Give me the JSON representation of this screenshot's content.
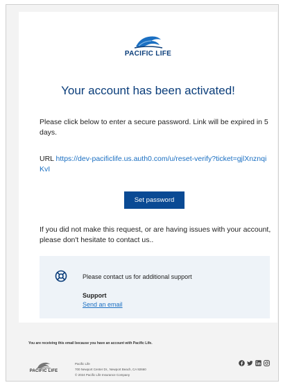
{
  "brand": {
    "name": "PACIFIC LIFE",
    "color": "#0a3d7a"
  },
  "email": {
    "headline": "Your account has been activated!",
    "intro": "Please click below to enter a secure password. Link will be expired in 5 days.",
    "url_label": "URL",
    "url": "https://dev-pacificlife.us.auth0.com/u/reset-verify?ticket=gjlXnznqiKvI",
    "button_label": "Set password",
    "notice": "If you did not make this request, or are having issues with your account, please don't hesitate to contact us.."
  },
  "support": {
    "message": "Please contact us for additional support",
    "title": "Support",
    "link_label": "Send an email",
    "icon": "lifebuoy-icon"
  },
  "footer": {
    "note": "You are receiving this email because you have an account with Pacific Life.",
    "logo_text": "PACIFIC LIFE",
    "address_lines": [
      "Pacific Life",
      "700 Newport Center Dr., Newport Beach, CA 92660",
      "© 2024 Pacific Life Insurance Company"
    ],
    "socials": [
      "facebook-icon",
      "twitter-icon",
      "linkedin-icon",
      "instagram-icon"
    ]
  },
  "colors": {
    "button": "#0a4a94",
    "link": "#1a6fc2",
    "support_bg": "#eef3f8"
  }
}
